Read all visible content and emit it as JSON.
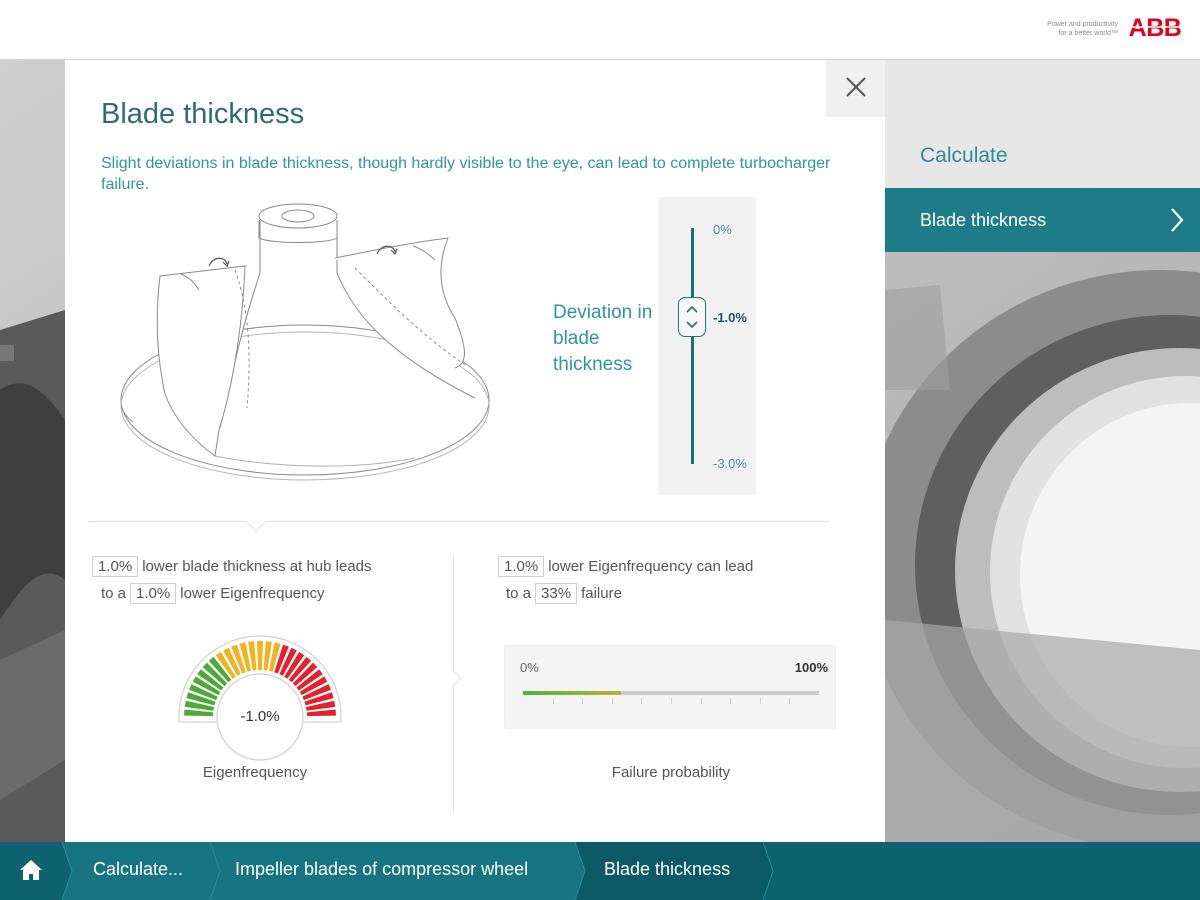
{
  "header": {
    "tagline_line1": "Power and productivity",
    "tagline_line2": "for a better world™",
    "logo_text": "ABB"
  },
  "right_panel": {
    "title": "Calculate",
    "selected_item": "Blade thickness"
  },
  "modal": {
    "title": "Blade thickness",
    "subtitle": "Slight deviations in blade thickness, though hardly visible to the eye, can lead to complete turbocharger failure.",
    "deviation_label": "Deviation in blade thickness",
    "slider": {
      "top_label": "0%",
      "current_label": "-1.0%",
      "bottom_label": "-3.0%",
      "value": -1.0,
      "min": -3.0,
      "max": 0
    },
    "statement_left": {
      "value1": "1.0%",
      "text1": "lower blade thickness at hub leads",
      "text2": "to a",
      "value2": "1.0%",
      "text3": "lower Eigenfrequency"
    },
    "statement_right": {
      "value1": "1.0%",
      "text1": "lower Eigenfrequency can lead",
      "text2": "to a",
      "value2": "33%",
      "text3": "failure"
    },
    "gauge": {
      "value": "-1.0%",
      "label": "Eigenfrequency",
      "colors": [
        "#4ea83a",
        "#f0b323",
        "#e0232e"
      ]
    },
    "probability": {
      "min_label": "0%",
      "max_label": "100%",
      "value_fraction": 0.33,
      "label": "Failure probability"
    }
  },
  "breadcrumb": {
    "items": [
      {
        "label": "Calculate..."
      },
      {
        "label": "Impeller blades of compressor wheel"
      },
      {
        "label": "Blade thickness"
      }
    ]
  },
  "colors": {
    "teal_dark": "#0f6370",
    "teal": "#1d7c88",
    "teal_text": "#2f95a3",
    "abb_red": "#e2001a"
  }
}
